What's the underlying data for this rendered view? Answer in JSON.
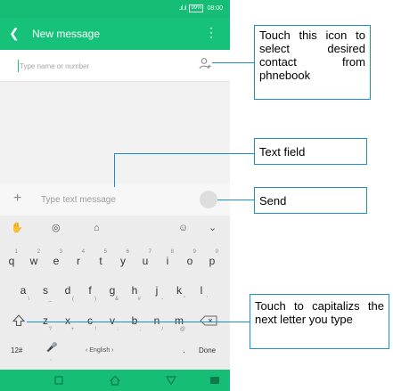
{
  "status_bar": {
    "signal": "..ıl ..ıl",
    "battery": "99%",
    "time": "08:00"
  },
  "app_bar": {
    "back_icon": "arrow-left-icon",
    "title": "New message",
    "more_icon": "more-vert-icon"
  },
  "recipient": {
    "placeholder": "Type name or number",
    "contact_icon": "add-contact-icon"
  },
  "compose": {
    "attach_icon": "plus-icon",
    "placeholder": "Type text message",
    "send_icon": "send-icon"
  },
  "keyboard": {
    "top_icons": [
      "hand-icon",
      "globe-icon",
      "shirt-icon",
      "emoji-icon",
      "chevron-down-icon"
    ],
    "top_glyphs": [
      "✋",
      "◎",
      "⌂",
      "☺",
      "⌄"
    ],
    "row1": [
      {
        "key": "q",
        "hint": "1"
      },
      {
        "key": "w",
        "hint": "2"
      },
      {
        "key": "e",
        "hint": "3"
      },
      {
        "key": "r",
        "hint": "4"
      },
      {
        "key": "t",
        "hint": "5"
      },
      {
        "key": "y",
        "hint": "6"
      },
      {
        "key": "u",
        "hint": "7"
      },
      {
        "key": "i",
        "hint": "8"
      },
      {
        "key": "o",
        "hint": "9"
      },
      {
        "key": "p",
        "hint": "0"
      }
    ],
    "row2": [
      {
        "key": "a",
        "sub": "\\"
      },
      {
        "key": "s",
        "sub": "_"
      },
      {
        "key": "d",
        "sub": "("
      },
      {
        "key": "f",
        "sub": ")"
      },
      {
        "key": "g",
        "sub": "&"
      },
      {
        "key": "h",
        "sub": "#"
      },
      {
        "key": "j",
        "sub": "-"
      },
      {
        "key": "k",
        "sub": "\""
      },
      {
        "key": "l",
        "sub": "'"
      }
    ],
    "row3": [
      {
        "key": "z",
        "sub": "?"
      },
      {
        "key": "x",
        "sub": "+"
      },
      {
        "key": "c",
        "sub": "!"
      },
      {
        "key": "v",
        "sub": ":"
      },
      {
        "key": "b",
        "sub": ";"
      },
      {
        "key": "n",
        "sub": "/"
      },
      {
        "key": "m",
        "sub": "@"
      }
    ],
    "shift_icon": "shift-arrow-icon",
    "delete_icon": "backspace-icon",
    "symbols_label": "12#",
    "mic_icon": "microphone-icon",
    "comma": ",",
    "language": "‹ English ›",
    "period": ".",
    "done_label": "Done"
  },
  "nav_bar": {
    "icons": [
      "square-icon",
      "home-icon",
      "back-triangle-icon",
      "menu-icon"
    ]
  },
  "callouts": {
    "contact": "Touch this icon to select desired contact from phnebook",
    "text_field": "Text field",
    "send": "Send",
    "capitalize": "Touch to capitalizs the next letter you type"
  },
  "colors": {
    "header_green": "#16c27a",
    "callout_blue": "#1b8fd0"
  }
}
